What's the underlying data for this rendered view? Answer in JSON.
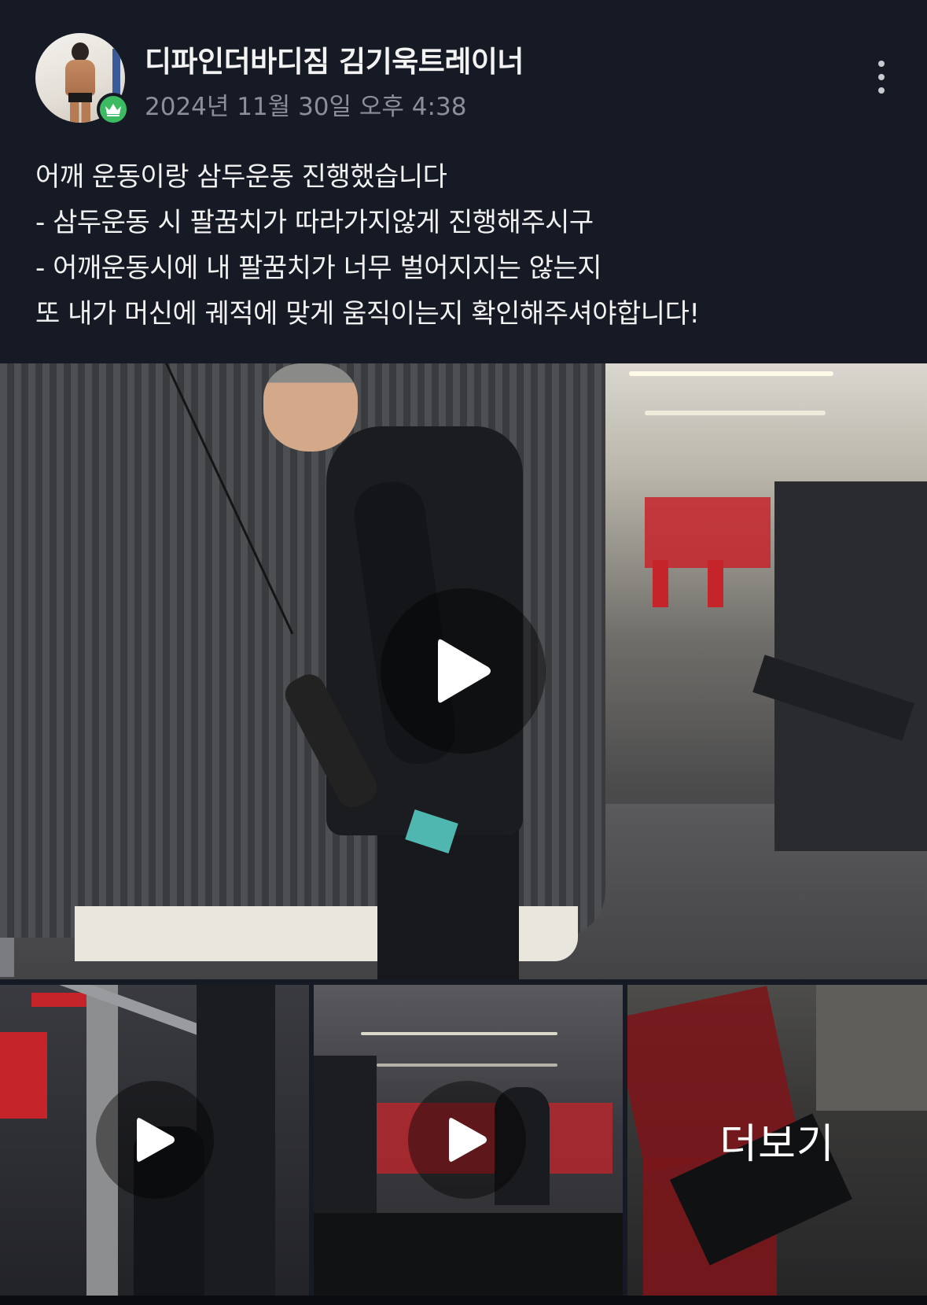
{
  "post": {
    "author": {
      "name": "디파인더바디짐 김기욱트레이너",
      "avatar": "avatar-photo",
      "badge_icon": "crown-icon",
      "badge_color": "#3dbb63"
    },
    "timestamp": "2024년 11월 30일 오후 4:38",
    "more_icon": "more-vertical-icon",
    "body_lines": [
      "어깨 운동이랑 삼두운동 진행했습니다",
      "- 삼두운동 시 팔꿈치가 따라가지않게 진행해주시구",
      "- 어깨운동시에 내 팔꿈치가 너무 벌어지지는 않는지",
      "또 내가 머신에 궤적에 맞게 움직이는지 확인해주셔야합니다!"
    ],
    "media": {
      "main_video": {
        "icon": "play-icon"
      },
      "thumbnails": [
        {
          "icon": "play-icon"
        },
        {
          "icon": "play-icon"
        },
        {
          "overlay_label": "더보기"
        }
      ]
    },
    "colors": {
      "background": "#161a24",
      "text": "#f2f2f2",
      "secondary_text": "#8b8f99",
      "accent_red": "#c5242a"
    }
  }
}
